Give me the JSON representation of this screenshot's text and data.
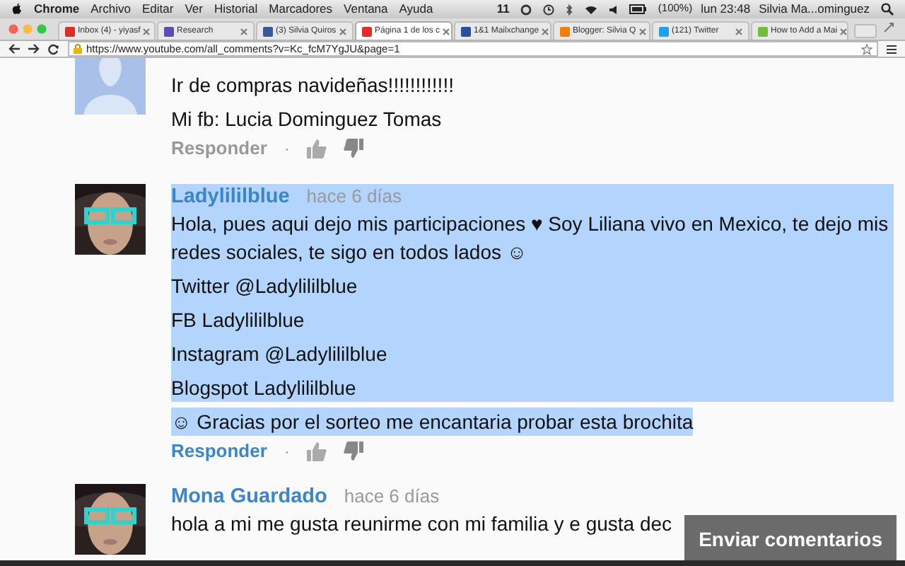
{
  "menu_bar": {
    "items": [
      "Chrome",
      "Archivo",
      "Editar",
      "Ver",
      "Historial",
      "Marcadores",
      "Ventana",
      "Ayuda"
    ],
    "mail_count": "11",
    "battery": "(100%)",
    "clock": "lun 23:48",
    "user": "Silvia Ma...ominguez"
  },
  "tabs": [
    {
      "label": "Inbox (4) - yiyasf",
      "color": "#d93025",
      "selected": false
    },
    {
      "label": "Research",
      "color": "#5a4fb0",
      "selected": false
    },
    {
      "label": "(3) Silvia Quiros",
      "color": "#3b5998",
      "selected": false
    },
    {
      "label": "Página 1 de los c",
      "color": "#e52d27",
      "selected": true
    },
    {
      "label": "1&1 Mailxchange",
      "color": "#2b4fa0",
      "selected": false
    },
    {
      "label": "Blogger: Silvia Q",
      "color": "#f57d00",
      "selected": false
    },
    {
      "label": "(121) Twitter",
      "color": "#1da1f2",
      "selected": false
    },
    {
      "label": "How to Add a Mai",
      "color": "#6fbf3a",
      "selected": false
    }
  ],
  "address_bar": {
    "url": "https://www.youtube.com/all_comments?v=Kc_fcM7YgJU&page=1"
  },
  "comments": [
    {
      "kind": "placeholder",
      "paragraphs": [
        "Ir de compras navideñas!!!!!!!!!!!!",
        "Mi fb: Lucia Dominguez Tomas"
      ],
      "reply": "Responder",
      "separator": "·",
      "reply_active": false,
      "highlighted": false
    },
    {
      "kind": "picture",
      "author": "Ladylililblue",
      "time": "hace 6 días",
      "paragraphs": [
        "Hola, pues aqui dejo mis participaciones ♥ Soy Liliana vivo en Mexico, te dejo mis redes sociales, te sigo en todos lados ☺",
        "Twitter @Ladylililblue",
        "FB Ladylililblue",
        "Instagram @Ladylililblue",
        "Blogspot Ladylililblue",
        "☺ Gracias por el sorteo me encantaria probar esta brochita"
      ],
      "reply": "Responder",
      "separator": "·",
      "reply_active": true,
      "highlighted": true
    },
    {
      "kind": "picture",
      "author": "Mona Guardado",
      "time": "hace 6 días",
      "paragraphs": [
        "hola a mi me gusta reunirme con mi familia y e gusta dec"
      ],
      "highlighted": false
    }
  ],
  "feedback_button": "Enviar comentarios"
}
